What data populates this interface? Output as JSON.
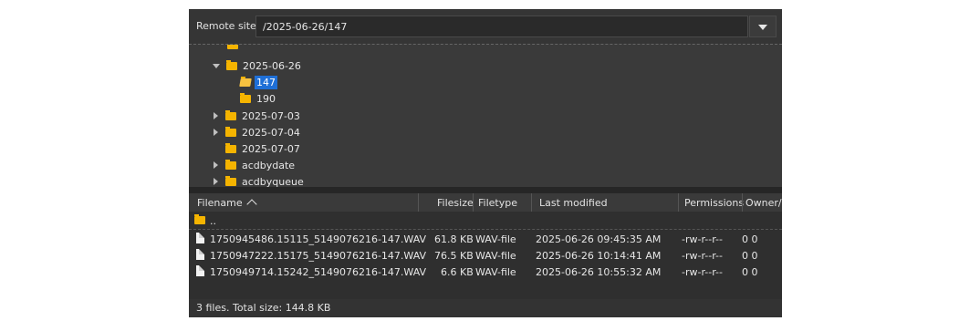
{
  "remote": {
    "label": "Remote site:",
    "path": "/2025-06-26/147"
  },
  "tree": {
    "items": [
      {
        "label": "2025-06-26",
        "state": "expanded"
      },
      {
        "label": "147",
        "state": "selected"
      },
      {
        "label": "190",
        "state": "leaf"
      },
      {
        "label": "2025-07-03",
        "state": "collapsed"
      },
      {
        "label": "2025-07-04",
        "state": "collapsed"
      },
      {
        "label": "2025-07-07",
        "state": "leaf"
      },
      {
        "label": "acdbydate",
        "state": "collapsed"
      },
      {
        "label": "acdbyqueue",
        "state": "collapsed"
      }
    ]
  },
  "columns": {
    "filename": "Filename",
    "filesize": "Filesize",
    "filetype": "Filetype",
    "last_modified": "Last modified",
    "permissions": "Permissions",
    "owner": "Owner/"
  },
  "files": {
    "parent": "..",
    "rows": [
      {
        "name": "1750945486.15115_5149076216-147.WAV",
        "size": "61.8 KB",
        "type": "WAV-file",
        "modified": "2025-06-26 09:45:35 AM",
        "perms": "-rw-r--r--",
        "owner": "0 0"
      },
      {
        "name": "1750947222.15175_5149076216-147.WAV",
        "size": "76.5 KB",
        "type": "WAV-file",
        "modified": "2025-06-26 10:14:41 AM",
        "perms": "-rw-r--r--",
        "owner": "0 0"
      },
      {
        "name": "1750949714.15242_5149076216-147.WAV",
        "size": "6.6 KB",
        "type": "WAV-file",
        "modified": "2025-06-26 10:55:32 AM",
        "perms": "-rw-r--r--",
        "owner": "0 0"
      }
    ]
  },
  "status": {
    "text": "3 files. Total size: 144.8 KB"
  },
  "colors": {
    "panel_bg": "#2f2f2f",
    "selection": "#1f6fd6",
    "folder": "#f5b400"
  }
}
